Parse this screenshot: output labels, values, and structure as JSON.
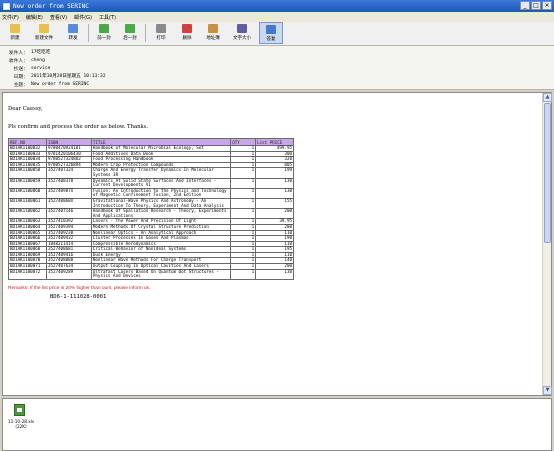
{
  "window": {
    "title": "New order from SERINC",
    "buttons": [
      "_",
      "□",
      "×"
    ]
  },
  "menu": [
    "文件(F)",
    "编辑(E)",
    "查看(V)",
    "邮件(G)",
    "工具(T)"
  ],
  "toolbar": [
    {
      "label": "新建",
      "icon": "new-icon",
      "color": "#e8c050"
    },
    {
      "label": "新建文件",
      "icon": "new-folder-icon",
      "color": "#e8c050"
    },
    {
      "label": "转发",
      "icon": "forward-icon",
      "color": "#5a8ad8"
    },
    {
      "label": "前一封",
      "icon": "previous-icon",
      "color": "#4aa84a"
    },
    {
      "label": "后一封",
      "icon": "next-icon",
      "color": "#4aa84a"
    },
    {
      "label": "打印",
      "icon": "print-icon",
      "color": "#8a8a8a"
    },
    {
      "label": "删除",
      "icon": "delete-icon",
      "color": "#d04040"
    },
    {
      "label": "地址簿",
      "icon": "address-book-icon",
      "color": "#c89040"
    },
    {
      "label": "文字大小",
      "icon": "font-size-icon",
      "color": "#6060a0"
    },
    {
      "label": "答复",
      "icon": "reply-icon",
      "color": "#4878c8"
    }
  ],
  "header": {
    "from_label": "发件人：",
    "from_value": "17吃吃吃",
    "to_label": "收件人：",
    "to_value": "cheng",
    "cc_label": "抄送：",
    "cc_value": "service",
    "date_label": "日期：",
    "date_value": "2011年10月28日星期五 10:13:32",
    "subject_label": "主题：",
    "subject_value": "New order from SERINC"
  },
  "body": {
    "greeting": "Dear Caessy,",
    "intro": "Pls confirm and process the order as below. Thanks.",
    "columns": [
      "REF.NO",
      "ISBN",
      "TITLE",
      "QTY",
      "List PRICE"
    ],
    "rows": [
      [
        "BD1AK1100032",
        "9780470924181",
        "Handbook of Molecular Microbial Ecology, Set",
        "1",
        "499.95"
      ],
      [
        "BD1AK1100033",
        "9781420106430",
        "Food Additives Data Book",
        "1",
        "300"
      ],
      [
        "BD1AK1100034",
        "9780527324882",
        "Food Processing Handbook",
        "1",
        "320"
      ],
      [
        "BD1AK1100035",
        "9780527326894",
        "Modern Crop Protection Compounds",
        "1",
        "805"
      ],
      [
        "BD1AK1100058",
        "3527407324",
        "Charge And Energy Transfer Dynamics In Molecular Systems 3R",
        "1",
        "199"
      ],
      [
        "BD1AK1100059",
        "3527408378",
        "Dynamics At Solid State Surfaces And Interfaces - Current Developments V1",
        "1",
        "130"
      ],
      [
        "BD1AK1100060",
        "352740987X",
        "Fusion: An Introduction to the Physics and Technology of Magnetic Confinement Fusion, 2nd Edition",
        "1",
        "130"
      ],
      [
        "BD1AK1100061",
        "352740868X",
        "Gravitational-Wave Physics And Astronomy - An Introduction To Theory, Experiment And Data Analysis",
        "1",
        "155"
      ],
      [
        "BD1AK1100062",
        "3527407146",
        "Handbook Of Spallation Research - Theory, Experiments And Applications",
        "1",
        "200"
      ],
      [
        "BD1AK1100063",
        "3527410392",
        "Lasers - The Power And Precision Of Light",
        "1",
        "39.95"
      ],
      [
        "BD1AK1100064",
        "3527409394",
        "Modern Methods Of Crystal Structure Prediction",
        "1",
        "200"
      ],
      [
        "BD1AK1100065",
        "3527409238",
        "Nonlinear Optics - An Analytical Approach",
        "1",
        "110"
      ],
      [
        "BD1AK1100066",
        "3527409432",
        "Cluster Processes In Gases And Plasmas",
        "1",
        "190"
      ],
      [
        "BD1AK1100067",
        "1848211414",
        "Compressible Aerodynamics",
        "1",
        "110"
      ],
      [
        "BD1AK1100068",
        "3527408681",
        "Critical Behavior of Nonideal Systems",
        "1",
        "195"
      ],
      [
        "BD1AK1100069",
        "3527409416",
        "Dusk Energy",
        "1",
        "110"
      ],
      [
        "BD1AK1100070",
        "3527408088",
        "Nonlinear Wave Methods For Charge Transport",
        "1",
        "140"
      ],
      [
        "BD1AK1100071",
        "3527407634",
        "Output Coupling In Optical Cavities And Lasers",
        "1",
        "200"
      ],
      [
        "BD1AK1100072",
        "3527409289",
        "Ultrafast Lasers Based On Quantum Dot Structures - Physics And Devices",
        "1",
        "130"
      ]
    ],
    "remarks": "Remarks: If the list price is 20% higher than ours, please inform us.",
    "reference": "BD6-1-111028-0001"
  },
  "attachment": {
    "name": "11-10-28.xls",
    "size": "(22K)"
  },
  "colors": {
    "table_header": "#c9a6ea",
    "remarks": "#d02020",
    "titlebar": "#2a60c8"
  }
}
